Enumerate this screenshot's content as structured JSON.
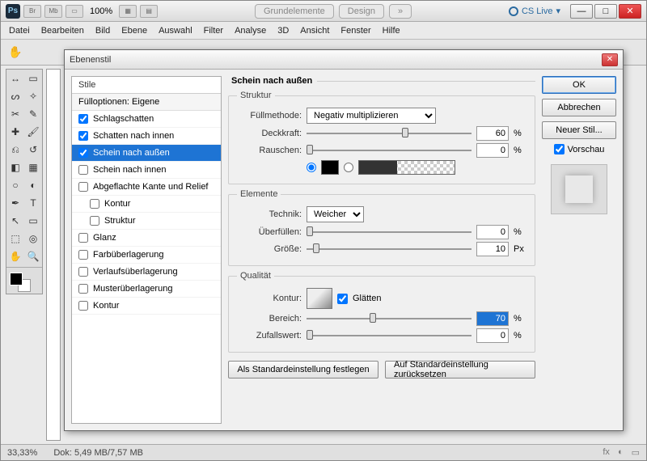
{
  "app": {
    "titlebar": {
      "zoom": "100%",
      "tab_grund": "Grundelemente",
      "tab_design": "Design",
      "cslive": "CS Live"
    },
    "menu": [
      "Datei",
      "Bearbeiten",
      "Bild",
      "Ebene",
      "Auswahl",
      "Filter",
      "Analyse",
      "3D",
      "Ansicht",
      "Fenster",
      "Hilfe"
    ],
    "status": {
      "zoom": "33,33%",
      "doc": "Dok: 5,49 MB/7,57 MB"
    }
  },
  "dialog": {
    "title": "Ebenenstil",
    "styles_header": "Stile",
    "fill_options": "Fülloptionen: Eigene",
    "items": [
      {
        "label": "Schlagschatten",
        "checked": true
      },
      {
        "label": "Schatten nach innen",
        "checked": true
      },
      {
        "label": "Schein nach außen",
        "checked": true,
        "selected": true
      },
      {
        "label": "Schein nach innen",
        "checked": false
      },
      {
        "label": "Abgeflachte Kante und Relief",
        "checked": false
      },
      {
        "label": "Kontur",
        "checked": false,
        "indent": true
      },
      {
        "label": "Struktur",
        "checked": false,
        "indent": true
      },
      {
        "label": "Glanz",
        "checked": false
      },
      {
        "label": "Farbüberlagerung",
        "checked": false
      },
      {
        "label": "Verlaufsüberlagerung",
        "checked": false
      },
      {
        "label": "Musterüberlagerung",
        "checked": false
      },
      {
        "label": "Kontur",
        "checked": false
      }
    ],
    "panel_title": "Schein nach außen",
    "struktur": {
      "legend": "Struktur",
      "fuellmethode_label": "Füllmethode:",
      "fuellmethode_value": "Negativ multiplizieren",
      "deckkraft_label": "Deckkraft:",
      "deckkraft_value": "60",
      "rauschen_label": "Rauschen:",
      "rauschen_value": "0",
      "pct": "%"
    },
    "elemente": {
      "legend": "Elemente",
      "technik_label": "Technik:",
      "technik_value": "Weicher",
      "ueberfuellen_label": "Überfüllen:",
      "ueberfuellen_value": "0",
      "groesse_label": "Größe:",
      "groesse_value": "10",
      "pct": "%",
      "px": "Px"
    },
    "qualitaet": {
      "legend": "Qualität",
      "kontur_label": "Kontur:",
      "glaetten_label": "Glätten",
      "bereich_label": "Bereich:",
      "bereich_value": "70",
      "zufall_label": "Zufallswert:",
      "zufall_value": "0",
      "pct": "%"
    },
    "bottom": {
      "save_default": "Als Standardeinstellung festlegen",
      "reset_default": "Auf Standardeinstellung zurücksetzen"
    },
    "buttons": {
      "ok": "OK",
      "cancel": "Abbrechen",
      "new_style": "Neuer Stil...",
      "preview": "Vorschau"
    }
  }
}
